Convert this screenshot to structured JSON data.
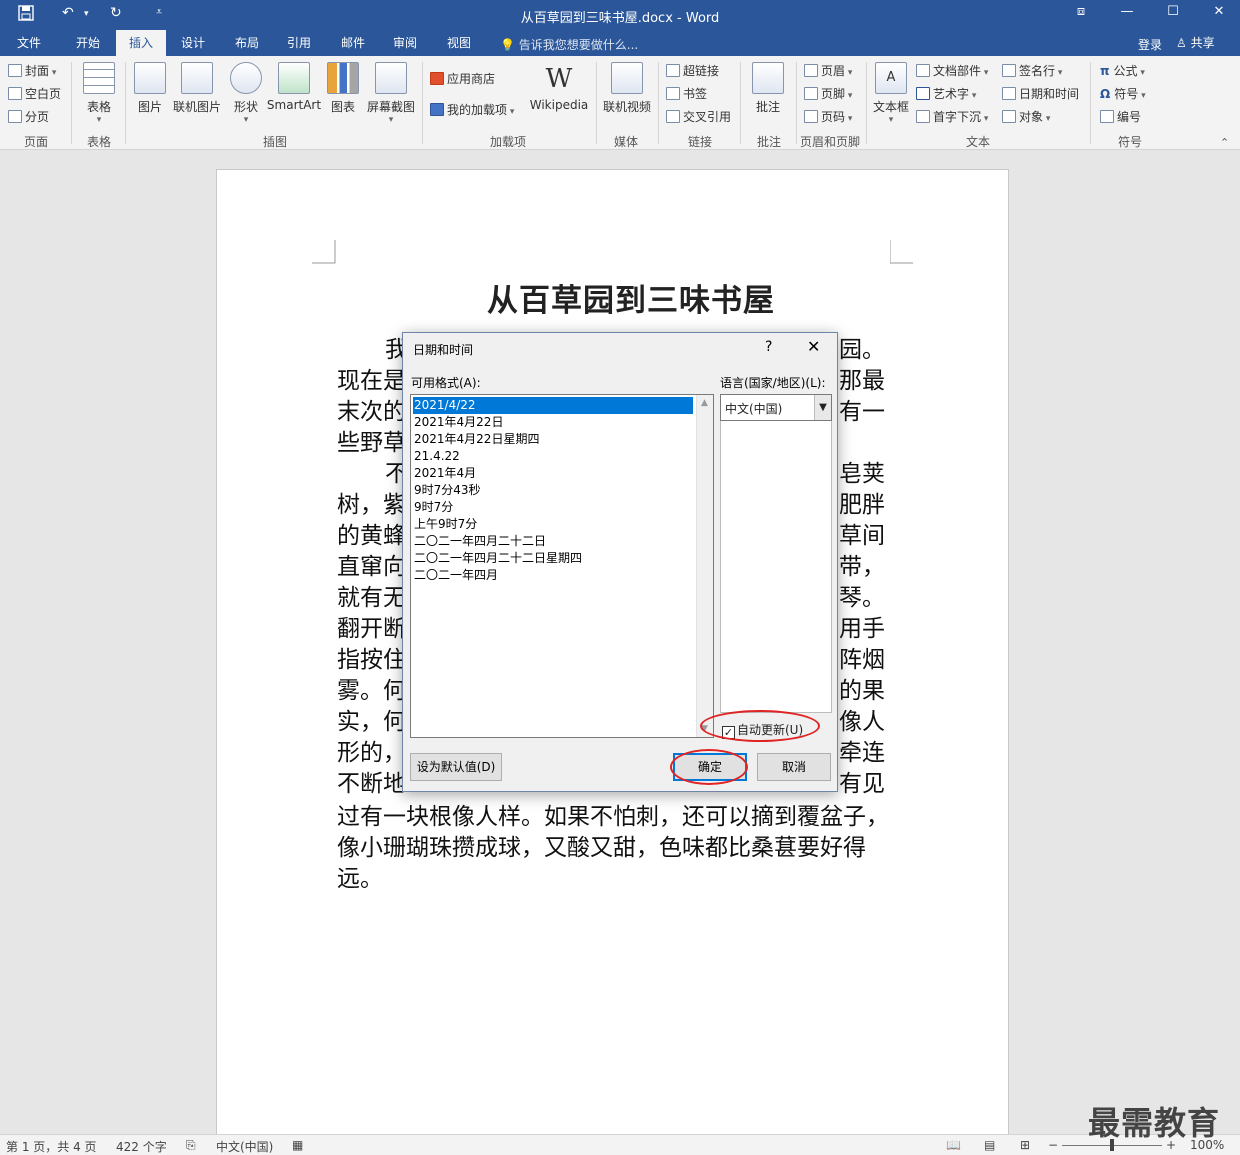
{
  "window": {
    "title": "从百草园到三味书屋.docx - Word",
    "controls": [
      "ribbon-display",
      "minimize",
      "maximize",
      "close"
    ]
  },
  "quick_access": {
    "save": "save-icon",
    "undo": "undo-icon",
    "redo": "redo-icon",
    "customize": "customize-icon"
  },
  "tabs": [
    {
      "label": "文件"
    },
    {
      "label": "开始"
    },
    {
      "label": "插入",
      "active": true
    },
    {
      "label": "设计"
    },
    {
      "label": "布局"
    },
    {
      "label": "引用"
    },
    {
      "label": "邮件"
    },
    {
      "label": "审阅"
    },
    {
      "label": "视图"
    }
  ],
  "tell_me": "告诉我您想要做什么...",
  "account": {
    "login": "登录",
    "share": "共享"
  },
  "ribbon": {
    "pages": {
      "items": [
        "封面",
        "空白页",
        "分页"
      ],
      "label": "页面"
    },
    "tables": {
      "button": "表格",
      "label": "表格"
    },
    "illustrations": {
      "buttons": [
        "图片",
        "联机图片",
        "形状",
        "SmartArt",
        "图表",
        "屏幕截图"
      ],
      "label": "插图"
    },
    "addins": {
      "store": "应用商店",
      "my_addins": "我的加载项",
      "wikipedia": "Wikipedia",
      "label": "加载项"
    },
    "media": {
      "button": "联机视频",
      "label": "媒体"
    },
    "links": {
      "items": [
        "超链接",
        "书签",
        "交叉引用"
      ],
      "label": "链接"
    },
    "comments": {
      "button": "批注",
      "label": "批注"
    },
    "header_footer": {
      "items": [
        "页眉",
        "页脚",
        "页码"
      ],
      "label": "页眉和页脚"
    },
    "text": {
      "textbox": "文本框",
      "col1": [
        "文档部件",
        "艺术字",
        "首字下沉"
      ],
      "col2": [
        "签名行",
        "日期和时间",
        "对象"
      ],
      "label": "文本"
    },
    "symbols": {
      "items": [
        "公式",
        "符号",
        "编号"
      ],
      "label": "符号"
    }
  },
  "document": {
    "title": "从百草园到三味书屋",
    "lines": [
      "我",
      "现在是",
      "末次的",
      "些野草",
      "不",
      "树，紫",
      "的黄蜂",
      "直窜向",
      "就有无",
      "翻开断",
      "指按住",
      "雾。何",
      "实，何",
      "形的，",
      "不断地",
      "过有一块根像人样。如果不怕刺，还可以摘到覆盆子，",
      "像小珊瑚珠攒成球，又酸又甜，色味都比桑葚要好得",
      "远。"
    ],
    "right_fragments": [
      "园。",
      "那最",
      "有一",
      "",
      "皂荚",
      "肥胖",
      "草间",
      "带，",
      "琴。",
      "用手",
      "阵烟",
      "的果",
      "像人",
      "牵连",
      "有见"
    ]
  },
  "dialog": {
    "title": "日期和时间",
    "help": "?",
    "close": "✕",
    "formats_label": "可用格式(A):",
    "formats": [
      "2021/4/22",
      "2021年4月22日",
      "2021年4月22日星期四",
      "21.4.22",
      "2021年4月",
      "9时7分43秒",
      "9时7分",
      "上午9时7分",
      "二〇二一年四月二十二日",
      "二〇二一年四月二十二日星期四",
      "二〇二一年四月"
    ],
    "selected_index": 0,
    "language_label": "语言(国家/地区)(L):",
    "language_value": "中文(中国)",
    "auto_update_label": "自动更新(U)",
    "auto_update_checked": true,
    "set_default": "设为默认值(D)",
    "ok": "确定",
    "cancel": "取消"
  },
  "status": {
    "page": "第 1 页，共 4 页",
    "words": "422 个字",
    "language": "中文(中国)",
    "zoom": "100%"
  },
  "watermark": "最需教育",
  "colors": {
    "accent": "#2b579a",
    "highlight": "#0078d7",
    "annotation": "#e02424"
  }
}
